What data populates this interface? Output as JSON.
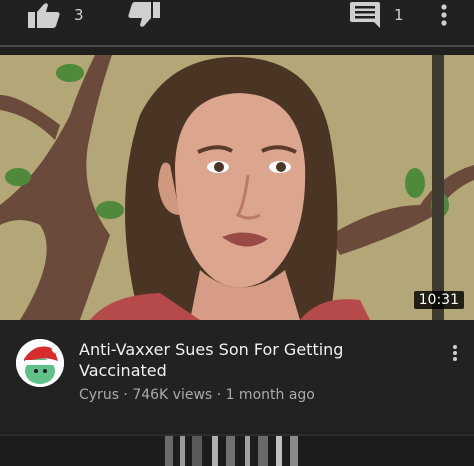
{
  "actions": {
    "like_count": "3",
    "comment_count": "1"
  },
  "video": {
    "duration": "10:31"
  },
  "info": {
    "title": "Anti-Vaxxer Sues Son For Getting Vaccinated",
    "meta": "Cyrus · 746K views · 1 month ago"
  },
  "colors": {
    "background": "#222222",
    "text_primary": "#f1f1f1",
    "text_secondary": "#aaaaaa"
  },
  "icons": [
    "thumbs-up-icon",
    "thumbs-down-icon",
    "comment-icon",
    "more-vert-icon"
  ]
}
